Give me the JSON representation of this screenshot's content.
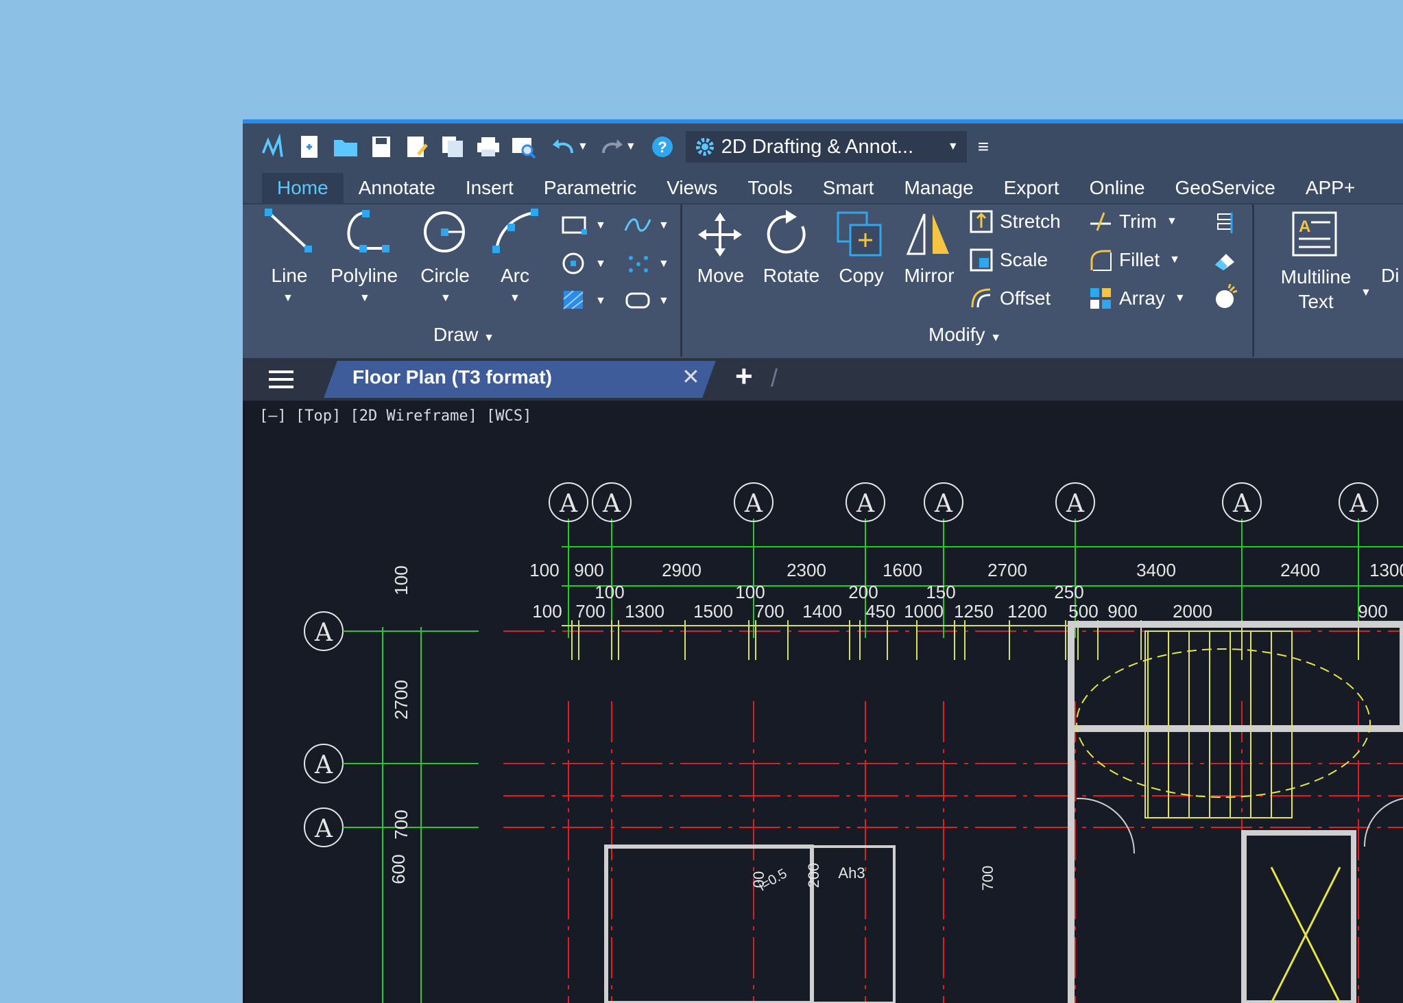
{
  "quick_access": {
    "workspace": "2D Drafting & Annot..."
  },
  "ribbon_tabs": [
    "Home",
    "Annotate",
    "Insert",
    "Parametric",
    "Views",
    "Tools",
    "Smart",
    "Manage",
    "Export",
    "Online",
    "GeoService",
    "APP+"
  ],
  "draw": {
    "line": "Line",
    "polyline": "Polyline",
    "circle": "Circle",
    "arc": "Arc",
    "panel": "Draw"
  },
  "modify": {
    "move": "Move",
    "rotate": "Rotate",
    "copy": "Copy",
    "mirror": "Mirror",
    "stretch": "Stretch",
    "scale": "Scale",
    "offset": "Offset",
    "trim": "Trim",
    "fillet": "Fillet",
    "array": "Array",
    "panel": "Modify"
  },
  "annotation": {
    "multiline_line1": "Multiline",
    "multiline_line2": "Text",
    "cut": "Di"
  },
  "document": {
    "tab_title": "Floor Plan (T3 format)"
  },
  "viewport": {
    "controls": "[—] [Top] [2D Wireframe] [WCS]"
  },
  "drawing": {
    "axis_label": "A",
    "dims_top": [
      "100",
      "900",
      "2900",
      "2300",
      "1600",
      "2700",
      "3400",
      "2400",
      "1300"
    ],
    "dims_mid": [
      "100",
      "100",
      "200",
      "150",
      "250"
    ],
    "dims_low": [
      "100",
      "700",
      "1300",
      "1500",
      "700",
      "1400",
      "450",
      "1000",
      "1250",
      "1200",
      "500",
      "900",
      "2000",
      "900"
    ],
    "dims_left": [
      "100",
      "2700",
      "600",
      "700"
    ],
    "room_tags": [
      "Ah3",
      "i=0.5",
      "200",
      "00",
      "700"
    ]
  },
  "colors": {
    "accent": "#5cc8ff",
    "ribbon": "#43536d",
    "canvas": "#161b26",
    "grid": "#e02020",
    "dim": "#20d020",
    "ext": "#d8e060"
  }
}
